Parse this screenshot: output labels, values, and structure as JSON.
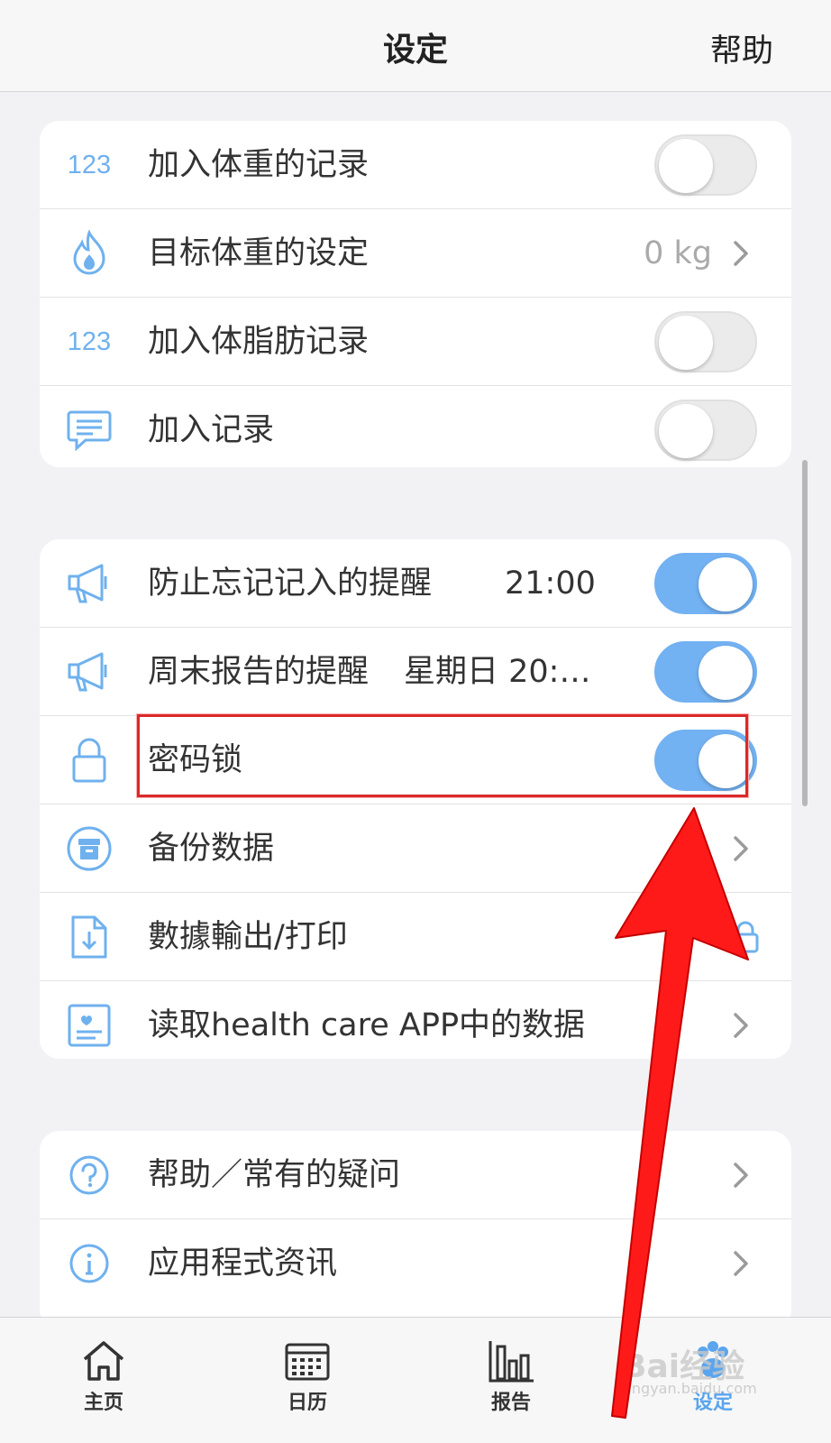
{
  "header": {
    "title": "设定",
    "help": "帮助"
  },
  "group1": [
    {
      "icon": "123",
      "label": "加入体重的记录",
      "toggle": false
    },
    {
      "icon": "flame-icon",
      "label": "目标体重的设定",
      "value": "0 kg"
    },
    {
      "icon": "123",
      "label": "加入体脂肪记录",
      "toggle": false
    },
    {
      "icon": "chat-bubble-icon",
      "label": "加入记录",
      "toggle": false
    }
  ],
  "group2": [
    {
      "icon": "megaphone-icon",
      "label": "防止忘记记入的提醒",
      "sub": "21:00",
      "toggle": true
    },
    {
      "icon": "megaphone-icon",
      "label": "周末报告的提醒",
      "sub": "星期日 20:…",
      "toggle": true
    },
    {
      "icon": "lock-icon",
      "label": "密码锁",
      "toggle": true
    },
    {
      "icon": "archive-box-icon",
      "label": "备份数据"
    },
    {
      "icon": "export-file-icon",
      "label": "數據輸出/打印"
    },
    {
      "icon": "health-card-icon",
      "label": "读取health care APP中的数据"
    }
  ],
  "group3": [
    {
      "icon": "question-circle-icon",
      "label": "帮助／常有的疑问"
    },
    {
      "icon": "info-circle-icon",
      "label": "应用程式资讯"
    }
  ],
  "tabs": [
    {
      "label": "主页",
      "icon": "home-icon"
    },
    {
      "label": "日历",
      "icon": "calendar-icon"
    },
    {
      "label": "报告",
      "icon": "bar-chart-icon"
    },
    {
      "label": "设定",
      "icon": "paw-icon",
      "active": true
    }
  ],
  "watermark": {
    "main": "Bai经验",
    "sub": "jingyan.baidu.com"
  },
  "colors": {
    "accent": "#72b1f2",
    "highlight": "#d82a2a",
    "arrow": "#ff1a1a"
  }
}
